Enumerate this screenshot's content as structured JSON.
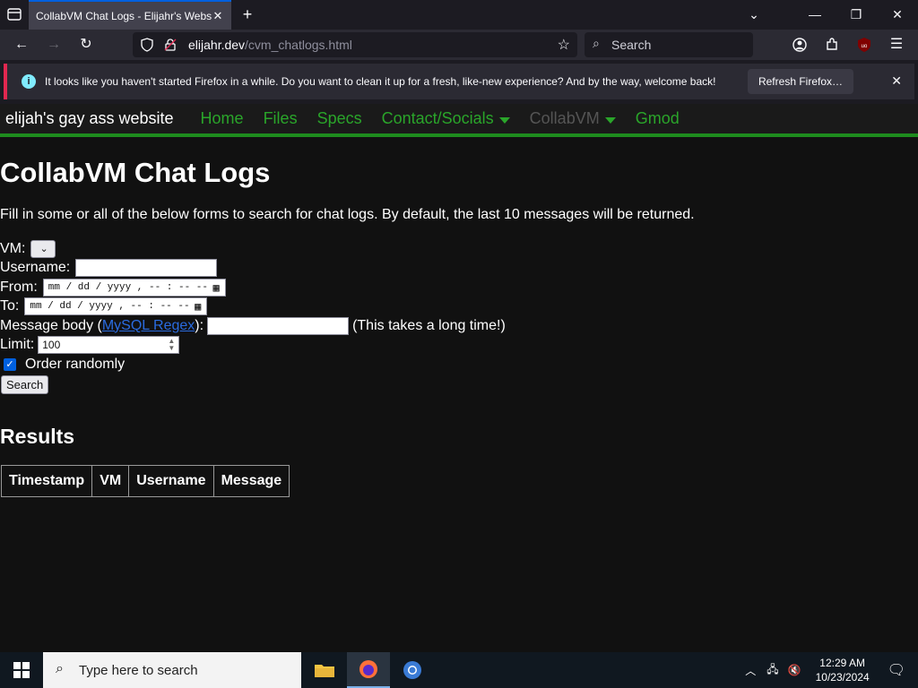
{
  "browser": {
    "tab_title": "CollabVM Chat Logs - Elijahr's Webs",
    "url_host": "elijahr.dev",
    "url_path": "/cvm_chatlogs.html",
    "search_placeholder": "Search",
    "notification": {
      "message": "It looks like you haven't started Firefox in a while. Do you want to clean it up for a fresh, like-new experience? And by the way, welcome back!",
      "button": "Refresh Firefox…"
    }
  },
  "site_nav": {
    "brand": "elijah's gay ass website",
    "links": [
      {
        "label": "Home"
      },
      {
        "label": "Files"
      },
      {
        "label": "Specs"
      },
      {
        "label": "Contact/Socials"
      },
      {
        "label": "CollabVM"
      },
      {
        "label": "Gmod"
      }
    ]
  },
  "page": {
    "title": "CollabVM Chat Logs",
    "lead": "Fill in some or all of the below forms to search for chat logs. By default, the last 10 messages will be returned.",
    "form": {
      "vm_label": "VM:",
      "username_label": "Username:",
      "from_label": "From:",
      "to_label": "To:",
      "datetime_placeholder": "mm / dd / yyyy ,  -- : --   --",
      "message_prefix": "Message body (",
      "regex_link": "MySQL Regex",
      "message_suffix": "):",
      "message_note": "(This takes a long time!)",
      "limit_label": "Limit:",
      "limit_value": "100",
      "order_label": "Order randomly",
      "search_button": "Search"
    },
    "results_heading": "Results",
    "table_headers": [
      "Timestamp",
      "VM",
      "Username",
      "Message"
    ]
  },
  "taskbar": {
    "search_placeholder": "Type here to search",
    "time": "12:29 AM",
    "date": "10/23/2024"
  }
}
